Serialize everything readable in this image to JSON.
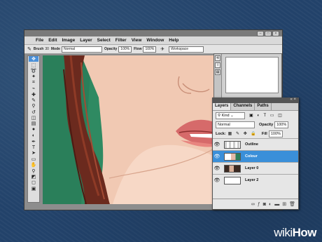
{
  "window": {
    "menu": [
      "File",
      "Edit",
      "Image",
      "Layer",
      "Select",
      "Filter",
      "View",
      "Window",
      "Help"
    ]
  },
  "options_bar": {
    "brush_label": "Brush",
    "brush_size": "30",
    "mode_label": "Mode",
    "mode_value": "Normal",
    "opacity_label": "Opacity",
    "opacity_value": "100%",
    "flow_label": "Flow",
    "flow_value": "100%",
    "workspace_value": "Workspace"
  },
  "layers_panel": {
    "tabs": [
      "Layers",
      "Channels",
      "Paths"
    ],
    "kind_label": "Kind",
    "blend_mode": "Normal",
    "opacity_label": "Opacity",
    "opacity_value": "100%",
    "lock_label": "Lock:",
    "fill_label": "Fill",
    "fill_value": "100%",
    "layers": [
      {
        "name": "Outline",
        "selected": false
      },
      {
        "name": "Colour",
        "selected": true
      },
      {
        "name": "Layer 0",
        "selected": false
      },
      {
        "name": "Layer 2",
        "selected": false
      }
    ]
  },
  "watermark": {
    "part1": "wiki",
    "part2": "How"
  }
}
